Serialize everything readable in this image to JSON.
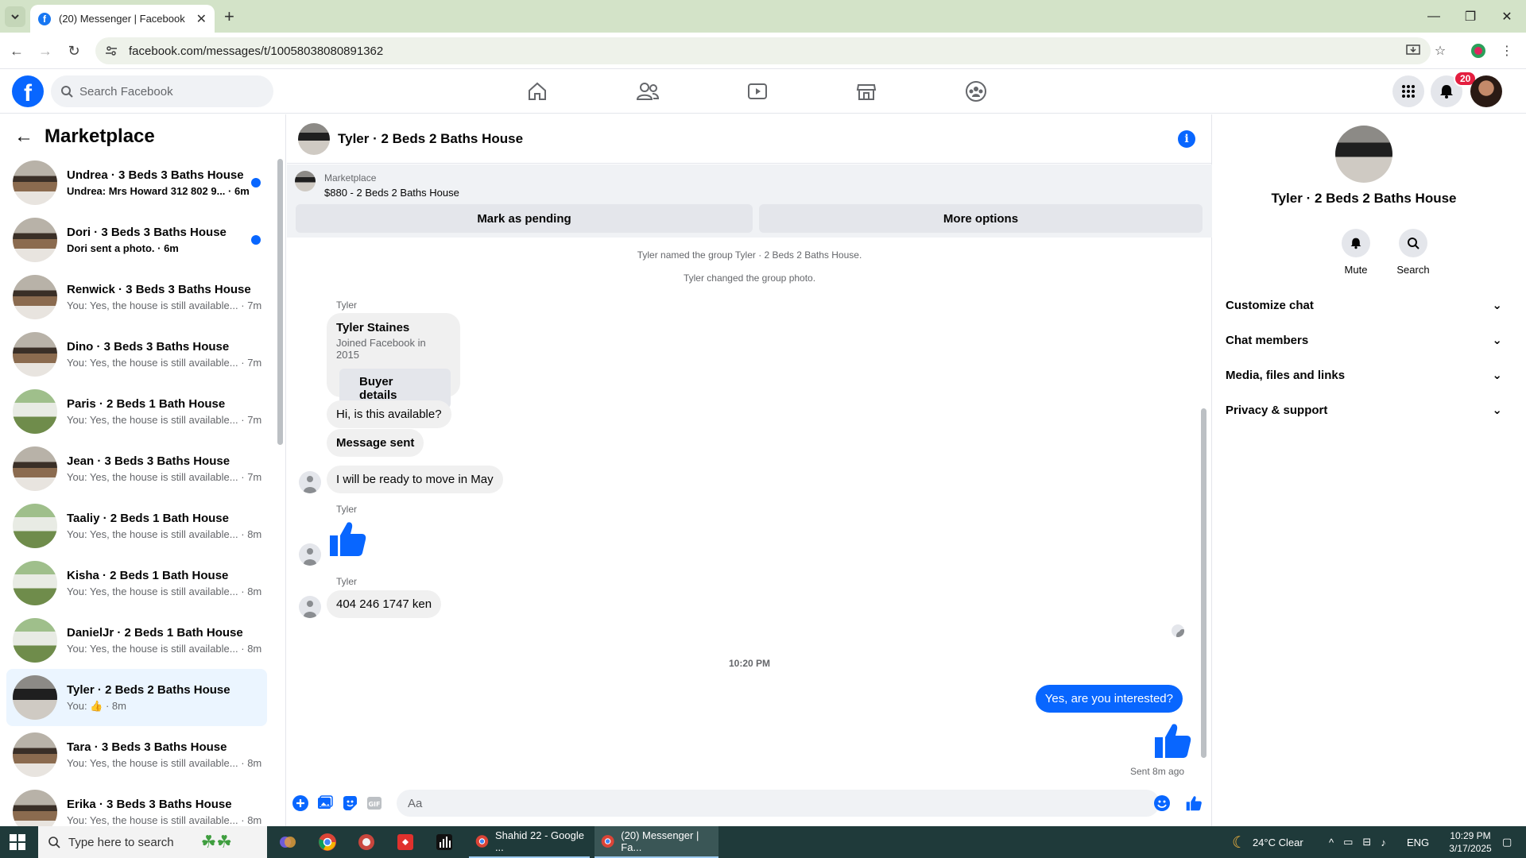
{
  "browser": {
    "tab_title": "(20) Messenger | Facebook",
    "url": "facebook.com/messages/t/10058038080891362"
  },
  "fbnav": {
    "search_placeholder": "Search Facebook",
    "notification_count": "20"
  },
  "sidebar": {
    "title": "Marketplace",
    "conversations": [
      {
        "name": "Undrea · 3 Beds 3 Baths House",
        "preview": "Undrea: Mrs Howard 312 802 9...",
        "time": "· 6m",
        "unread": true,
        "thumb": "interior"
      },
      {
        "name": "Dori · 3 Beds 3 Baths House",
        "preview": "Dori sent a photo.",
        "time": "· 6m",
        "unread": true,
        "thumb": "interior"
      },
      {
        "name": "Renwick · 3 Beds 3 Baths House",
        "preview": "You: Yes, the house is still available...",
        "time": "· 7m",
        "unread": false,
        "thumb": "interior"
      },
      {
        "name": "Dino · 3 Beds 3 Baths House",
        "preview": "You: Yes, the house is still available...",
        "time": "· 7m",
        "unread": false,
        "thumb": "interior"
      },
      {
        "name": "Paris · 2 Beds 1 Bath House",
        "preview": "You: Yes, the house is still available...",
        "time": "· 7m",
        "unread": false,
        "thumb": "exterior"
      },
      {
        "name": "Jean · 3 Beds 3 Baths House",
        "preview": "You: Yes, the house is still available...",
        "time": "· 7m",
        "unread": false,
        "thumb": "interior"
      },
      {
        "name": "Taaliy · 2 Beds 1 Bath House",
        "preview": "You: Yes, the house is still available...",
        "time": "· 8m",
        "unread": false,
        "thumb": "exterior"
      },
      {
        "name": "Kisha · 2 Beds 1 Bath House",
        "preview": "You: Yes, the house is still available...",
        "time": "· 8m",
        "unread": false,
        "thumb": "exterior"
      },
      {
        "name": "DanielJr · 2 Beds 1 Bath House",
        "preview": "You: Yes, the house is still available...",
        "time": "· 8m",
        "unread": false,
        "thumb": "exterior"
      },
      {
        "name": "Tyler · 2 Beds 2 Baths House",
        "preview": "You: 👍",
        "time": "· 8m",
        "unread": false,
        "thumb": "dark",
        "active": true
      },
      {
        "name": "Tara · 3 Beds 3 Baths House",
        "preview": "You: Yes, the house is still available...",
        "time": "· 8m",
        "unread": false,
        "thumb": "interior"
      },
      {
        "name": "Erika · 3 Beds 3 Baths House",
        "preview": "You: Yes, the house is still available...",
        "time": "· 8m",
        "unread": false,
        "thumb": "interior"
      }
    ]
  },
  "chat": {
    "title": "Tyler · 2 Beds 2 Baths House",
    "marketplace_label": "Marketplace",
    "listing": "$880 - 2 Beds 2 Baths House",
    "mark_pending": "Mark as pending",
    "more_options": "More options",
    "system_messages": [
      "Tyler named the group Tyler · 2 Beds 2 Baths House.",
      "Tyler changed the group photo."
    ],
    "sender_name": "Tyler",
    "card": {
      "name": "Tyler Staines",
      "sub": "Joined Facebook in 2015",
      "button": "Buyer details"
    },
    "messages": {
      "m1": "Hi, is this available?",
      "m2": "Message sent",
      "m3": "I will be ready to move in May",
      "m4": "404 246 1747 ken",
      "me1": "Yes, are you interested?"
    },
    "timestamp": "10:20 PM",
    "sent_label": "Sent 8m ago",
    "composer_placeholder": "Aa"
  },
  "rpanel": {
    "name": "Tyler · 2 Beds 2 Baths House",
    "actions": [
      "Mute",
      "Search"
    ],
    "sections": [
      "Customize chat",
      "Chat members",
      "Media, files and links",
      "Privacy & support"
    ]
  },
  "taskbar": {
    "search_placeholder": "Type here to search",
    "windows": [
      "Shahid 22 - Google ...",
      "(20) Messenger | Fa..."
    ],
    "weather": "24°C  Clear",
    "lang": "ENG",
    "time": "10:29 PM",
    "date": "3/17/2025"
  },
  "colors": {
    "accent": "#0866ff",
    "bubble_gray": "#f0f0f0",
    "badge_red": "#e41e3f"
  }
}
